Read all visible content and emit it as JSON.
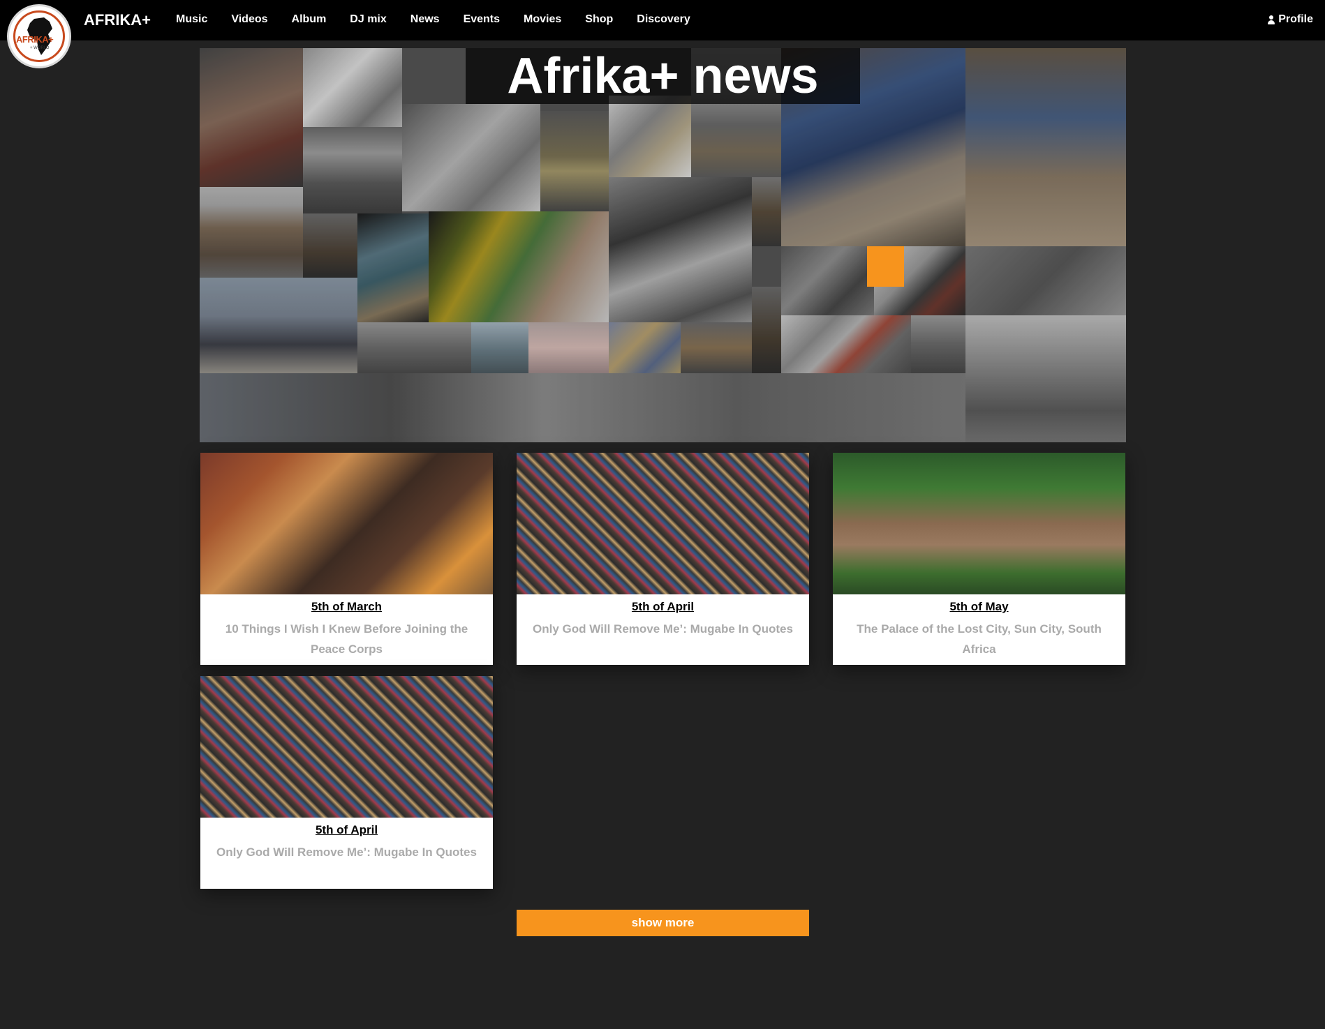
{
  "brand": {
    "logo_text": "AFRIKA+",
    "logo_sub": "+ WORLD",
    "name": "AFRIKA+"
  },
  "nav": {
    "items": [
      {
        "label": "Music"
      },
      {
        "label": "Videos"
      },
      {
        "label": "Album"
      },
      {
        "label": "DJ mix"
      },
      {
        "label": "News"
      },
      {
        "label": "Events"
      },
      {
        "label": "Movies"
      },
      {
        "label": "Shop"
      },
      {
        "label": "Discovery"
      }
    ],
    "profile_label": "Profile",
    "profile_icon": "user-icon"
  },
  "hero": {
    "title": "Afrika+ news"
  },
  "articles": [
    {
      "date": "5th of March",
      "title": "10 Things I Wish I Knew Before Joining the Peace Corps"
    },
    {
      "date": "5th of April",
      "title": "Only God Will Remove Me’: Mugabe In Quotes"
    },
    {
      "date": "5th of May",
      "title": "The Palace of the Lost City, Sun City, South Africa"
    },
    {
      "date": "5th of April",
      "title": "Only God Will Remove Me’: Mugabe In Quotes"
    }
  ],
  "show_more_label": "show more",
  "colors": {
    "background": "#222222",
    "navbar": "#000000",
    "accent": "#f7941d",
    "card_title": "#aaaaaa"
  }
}
